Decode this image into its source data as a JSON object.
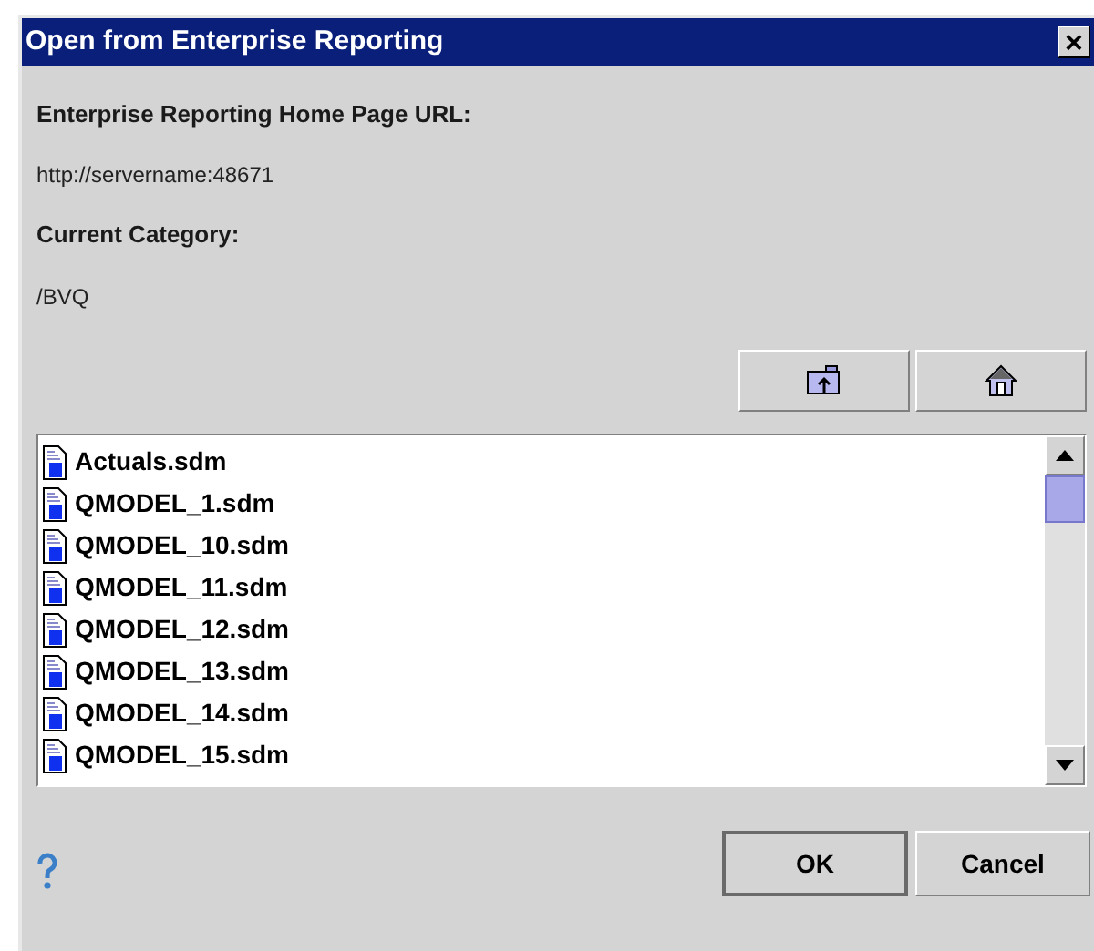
{
  "window": {
    "title": "Open from Enterprise Reporting",
    "close_glyph": "×"
  },
  "url_label": "Enterprise Reporting Home Page URL:",
  "url": "http://servername:48671",
  "category_label": "Current Category:",
  "category": "/BVQ",
  "files": [
    {
      "name": "Actuals.sdm",
      "selected": false
    },
    {
      "name": "QMODEL_1.sdm",
      "selected": false
    },
    {
      "name": "QMODEL_10.sdm",
      "selected": false
    },
    {
      "name": "QMODEL_11.sdm",
      "selected": false
    },
    {
      "name": "QMODEL_12.sdm",
      "selected": false
    },
    {
      "name": "QMODEL_13.sdm",
      "selected": false
    },
    {
      "name": "QMODEL_14.sdm",
      "selected": false
    },
    {
      "name": "QMODEL_15.sdm",
      "selected": false
    }
  ],
  "buttons": [
    {
      "label": "OK",
      "default": true
    },
    {
      "label": "Cancel",
      "default": false
    }
  ]
}
